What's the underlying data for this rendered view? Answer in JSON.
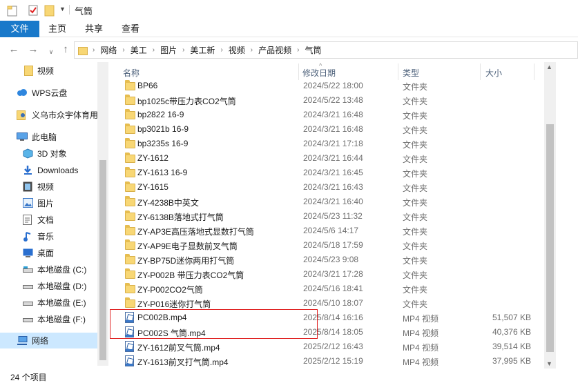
{
  "window": {
    "title": "气筒"
  },
  "ribbon": {
    "tabs": [
      "文件",
      "主页",
      "共享",
      "查看"
    ]
  },
  "address": {
    "crumbs": [
      "网络",
      "美工",
      "图片",
      "美工新",
      "视频",
      "产品视频",
      "气筒"
    ]
  },
  "navpane": {
    "items": [
      {
        "label": "视频",
        "icon": "folder-icon"
      },
      {
        "label": "WPS云盘",
        "icon": "cloud-icon"
      },
      {
        "label": "义乌市众宇体育用",
        "icon": "user-folder-icon"
      },
      {
        "label": "此电脑",
        "icon": "computer-icon"
      },
      {
        "label": "3D 对象",
        "icon": "3d-objects-icon"
      },
      {
        "label": "Downloads",
        "icon": "download-icon"
      },
      {
        "label": "视频",
        "icon": "video-icon"
      },
      {
        "label": "图片",
        "icon": "pictures-icon"
      },
      {
        "label": "文档",
        "icon": "documents-icon"
      },
      {
        "label": "音乐",
        "icon": "music-icon"
      },
      {
        "label": "桌面",
        "icon": "desktop-icon"
      },
      {
        "label": "本地磁盘 (C:)",
        "icon": "drive-icon"
      },
      {
        "label": "本地磁盘 (D:)",
        "icon": "drive-icon"
      },
      {
        "label": "本地磁盘 (E:)",
        "icon": "drive-icon"
      },
      {
        "label": "本地磁盘 (F:)",
        "icon": "drive-icon"
      },
      {
        "label": "网络",
        "icon": "network-icon"
      }
    ]
  },
  "columns": {
    "name": "名称",
    "date": "修改日期",
    "type": "类型",
    "size": "大小"
  },
  "files": [
    {
      "name": "BP66",
      "date": "2024/5/22 18:00",
      "type": "文件夹",
      "size": "",
      "kind": "folder"
    },
    {
      "name": "bp1025c带压力表CO2气筒",
      "date": "2024/5/22 13:48",
      "type": "文件夹",
      "size": "",
      "kind": "folder"
    },
    {
      "name": "bp2822  16-9",
      "date": "2024/3/21 16:48",
      "type": "文件夹",
      "size": "",
      "kind": "folder"
    },
    {
      "name": "bp3021b 16-9",
      "date": "2024/3/21 16:48",
      "type": "文件夹",
      "size": "",
      "kind": "folder"
    },
    {
      "name": "bp3235s  16-9",
      "date": "2024/3/21 17:18",
      "type": "文件夹",
      "size": "",
      "kind": "folder"
    },
    {
      "name": "ZY-1612",
      "date": "2024/3/21 16:44",
      "type": "文件夹",
      "size": "",
      "kind": "folder"
    },
    {
      "name": "ZY-1613 16-9",
      "date": "2024/3/21 16:45",
      "type": "文件夹",
      "size": "",
      "kind": "folder"
    },
    {
      "name": "ZY-1615",
      "date": "2024/3/21 16:43",
      "type": "文件夹",
      "size": "",
      "kind": "folder"
    },
    {
      "name": "ZY-4238B中英文",
      "date": "2024/3/21 16:40",
      "type": "文件夹",
      "size": "",
      "kind": "folder"
    },
    {
      "name": "ZY-6138B落地式打气筒",
      "date": "2024/5/23 11:32",
      "type": "文件夹",
      "size": "",
      "kind": "folder"
    },
    {
      "name": "ZY-AP3E高压落地式显数打气筒",
      "date": "2024/5/6 14:17",
      "type": "文件夹",
      "size": "",
      "kind": "folder"
    },
    {
      "name": "ZY-AP9E电子显数前叉气筒",
      "date": "2024/5/18 17:59",
      "type": "文件夹",
      "size": "",
      "kind": "folder"
    },
    {
      "name": "ZY-BP75D迷你两用打气筒",
      "date": "2024/5/23 9:08",
      "type": "文件夹",
      "size": "",
      "kind": "folder"
    },
    {
      "name": "ZY-P002B 带压力表CO2气筒",
      "date": "2024/3/21 17:28",
      "type": "文件夹",
      "size": "",
      "kind": "folder"
    },
    {
      "name": "ZY-P002CO2气筒",
      "date": "2024/5/16 18:41",
      "type": "文件夹",
      "size": "",
      "kind": "folder"
    },
    {
      "name": "ZY-P016迷你打气筒",
      "date": "2024/5/10 18:07",
      "type": "文件夹",
      "size": "",
      "kind": "folder"
    },
    {
      "name": "PC002B.mp4",
      "date": "2025/8/14 16:16",
      "type": "MP4 视频",
      "size": "51,507 KB",
      "kind": "mp4"
    },
    {
      "name": "PC002S  气筒.mp4",
      "date": "2025/8/14 18:05",
      "type": "MP4 视频",
      "size": "40,376 KB",
      "kind": "mp4"
    },
    {
      "name": "ZY-1612前叉气筒.mp4",
      "date": "2025/2/12 16:43",
      "type": "MP4 视频",
      "size": "39,514 KB",
      "kind": "mp4"
    },
    {
      "name": "ZY-1613前叉打气筒.mp4",
      "date": "2025/2/12 15:19",
      "type": "MP4 视频",
      "size": "37,995 KB",
      "kind": "mp4"
    }
  ],
  "status": {
    "item_count": "24 个项目"
  }
}
